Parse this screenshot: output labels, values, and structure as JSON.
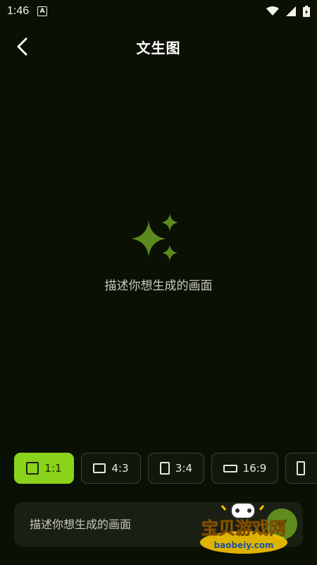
{
  "status_bar": {
    "time": "1:46",
    "app_badge": "A"
  },
  "header": {
    "title": "文生图"
  },
  "empty_state": {
    "text": "描述你想生成的画面"
  },
  "ratios": [
    {
      "label": "1:1",
      "active": true
    },
    {
      "label": "4:3",
      "active": false
    },
    {
      "label": "3:4",
      "active": false
    },
    {
      "label": "16:9",
      "active": false
    },
    {
      "label": "",
      "active": false
    }
  ],
  "prompt": {
    "placeholder": "描述你想生成的画面",
    "value": ""
  },
  "watermark": {
    "title": "宝贝游戏网",
    "url": "baobeiy.com"
  },
  "colors": {
    "accent": "#8ad21c",
    "background": "#0b1004",
    "sparkle": "#5b8a1e"
  }
}
